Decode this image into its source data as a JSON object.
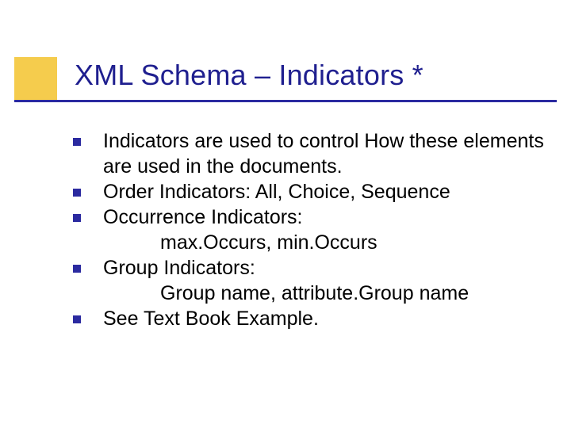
{
  "title": "XML Schema – Indicators *",
  "items": [
    {
      "text": "Indicators are used to control How these elements are used in the documents."
    },
    {
      "text": "Order Indicators: All, Choice, Sequence"
    },
    {
      "text": "Occurrence Indicators:",
      "sub": "max.Occurs, min.Occurs"
    },
    {
      "text": "Group Indicators:",
      "sub": "Group name, attribute.Group name"
    },
    {
      "text": "See Text Book Example."
    }
  ]
}
